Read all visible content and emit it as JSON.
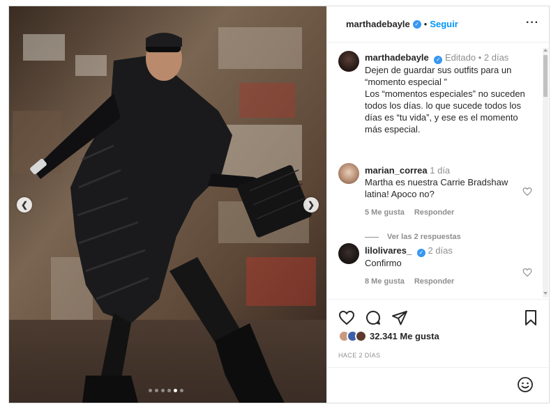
{
  "post": {
    "media": {
      "slide_count": 6,
      "active_slide": 5,
      "image_description_icon": "fashion-photo",
      "prev_arrow_icon": "chevron-left-icon",
      "next_arrow_icon": "chevron-right-icon"
    },
    "header": {
      "username": "marthadebayle",
      "verified": true,
      "separator": "•",
      "follow_label": "Seguir",
      "more_icon": "more-horizontal-icon"
    },
    "caption": {
      "username": "marthadebayle",
      "meta": "Editado • 2 días",
      "lines": [
        "Dejen de guardar sus outfits para un",
        "“momento especial ”",
        "Los “momentos especiales” no suceden",
        "todos los días. lo que sucede todos los",
        "días es “tu vida”, y ese es el momento",
        "más especial."
      ]
    },
    "comments": [
      {
        "username": "marian_correa",
        "time": "1 día",
        "text_lines": [
          "Martha es nuestra Carrie Bradshaw",
          "latina! Apoco no?"
        ],
        "likes_label": "5 Me gusta",
        "reply_label": "Responder",
        "view_replies_label": "Ver las 2 respuestas"
      },
      {
        "username": "lilolivares_",
        "verified": true,
        "time": "2 días",
        "text_lines": [
          "Confirmo"
        ],
        "likes_label": "8 Me gusta",
        "reply_label": "Responder"
      }
    ],
    "actions": {
      "like_icon": "heart-icon",
      "comment_icon": "comment-bubble-icon",
      "share_icon": "paper-plane-icon",
      "save_icon": "bookmark-icon"
    },
    "likes": {
      "count_label": "32.341 Me gusta"
    },
    "timestamp": "HACE 2 DÍAS",
    "add_comment": {
      "emoji_icon": "smiley-icon"
    },
    "colors": {
      "accent": "#0095f6",
      "verified": "#3897f0",
      "muted": "#8e8e8e",
      "text": "#262626"
    }
  }
}
